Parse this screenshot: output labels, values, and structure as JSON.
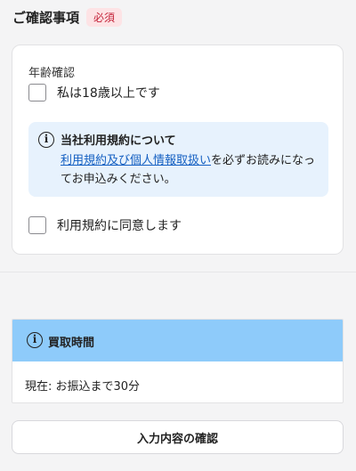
{
  "section": {
    "title": "ご確認事項",
    "required_badge": "必須"
  },
  "confirm_card": {
    "age_label": "年齢確認",
    "age_checkbox_label": "私は18歳以上です",
    "age_checked": false,
    "notice": {
      "icon": "info-icon",
      "title": "当社利用規約について",
      "link_text": "利用規約及び個人情報取扱い",
      "body_text": "を必ずお読みになってお申込みください。"
    },
    "terms_checkbox_label": "利用規約に同意します",
    "terms_checked": false
  },
  "purchase_time": {
    "icon": "info-icon",
    "title": "買取時間",
    "status": "現在: お振込まで30分"
  },
  "confirm_button_label": "入力内容の確認",
  "colors": {
    "badge_bg": "#fde3e5",
    "badge_text": "#c4243a",
    "notice_bg": "#e7f2fd",
    "link": "#1560c2",
    "time_header_bg": "#8ecbfa"
  }
}
